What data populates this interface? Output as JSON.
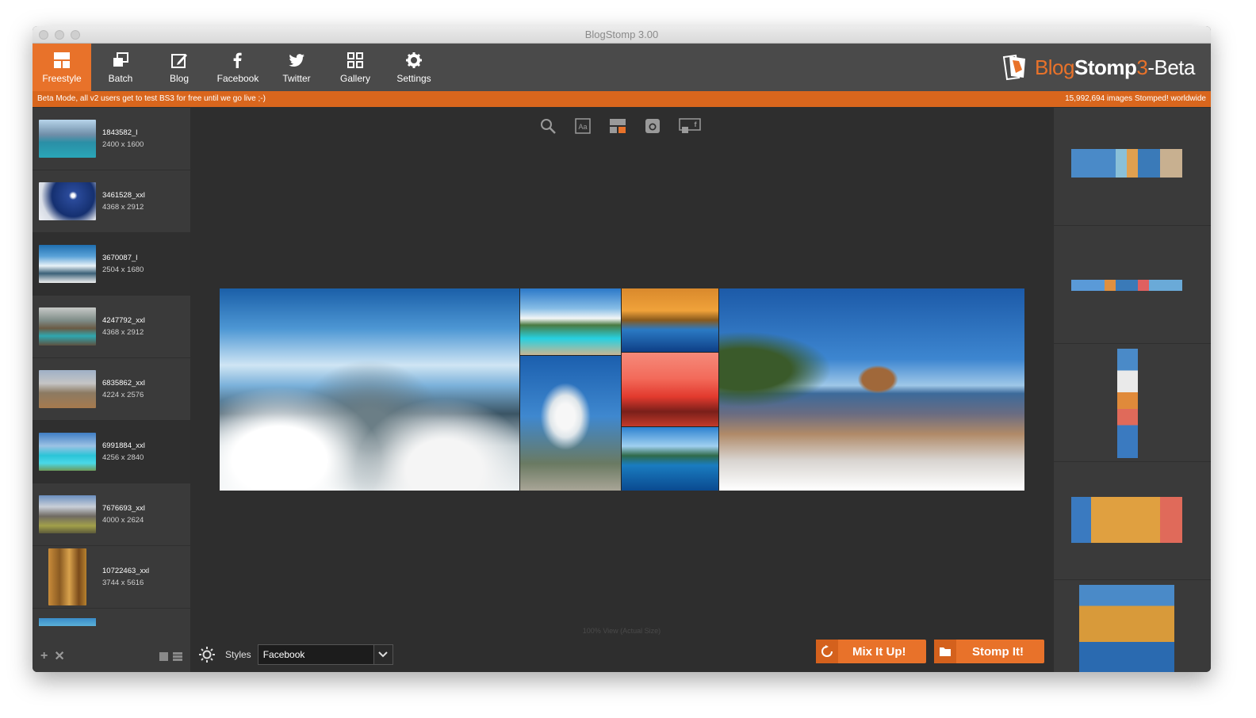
{
  "window": {
    "title": "BlogStomp 3.00"
  },
  "toolbar": {
    "items": [
      {
        "label": "Freestyle",
        "icon": "freestyle-layout-icon",
        "active": true
      },
      {
        "label": "Batch",
        "icon": "batch-stack-icon"
      },
      {
        "label": "Blog",
        "icon": "blog-edit-icon"
      },
      {
        "label": "Facebook",
        "icon": "facebook-icon"
      },
      {
        "label": "Twitter",
        "icon": "twitter-icon"
      },
      {
        "label": "Gallery",
        "icon": "gallery-grid-icon"
      },
      {
        "label": "Settings",
        "icon": "gear-icon"
      }
    ],
    "brand": {
      "part1": "Blog",
      "part2": "Stomp",
      "part3": "3",
      "part4": "-Beta"
    }
  },
  "banner": {
    "left": "Beta Mode, all v2 users get to test BS3 for free until we go live ;-)",
    "right": "15,992,694 images Stomped! worldwide"
  },
  "sidebar": {
    "items": [
      {
        "name": "1843582_l",
        "dims": "2400 x 1600"
      },
      {
        "name": "3461528_xxl",
        "dims": "4368 x 2912"
      },
      {
        "name": "3670087_l",
        "dims": "2504 x 1680"
      },
      {
        "name": "4247792_xxl",
        "dims": "4368 x 2912"
      },
      {
        "name": "6835862_xxl",
        "dims": "4224 x 2576"
      },
      {
        "name": "6991884_xxl",
        "dims": "4256 x 2840"
      },
      {
        "name": "7676693_xxl",
        "dims": "4000 x 2624"
      },
      {
        "name": "10722463_xxl",
        "dims": "3744 x 5616"
      }
    ]
  },
  "canvas": {
    "view_label": "100% View (Actual Size)",
    "icons": [
      "search-icon",
      "text-icon",
      "layout-icon",
      "instagram-icon",
      "facebook-preview-icon"
    ]
  },
  "bottom": {
    "styles_label": "Styles",
    "styles_value": "Facebook",
    "mix_label": "Mix It Up!",
    "stomp_label": "Stomp It!"
  },
  "colors": {
    "accent": "#e8722a",
    "banner": "#d9661d",
    "panel": "#3a3a3a",
    "background": "#2e2e2e"
  }
}
